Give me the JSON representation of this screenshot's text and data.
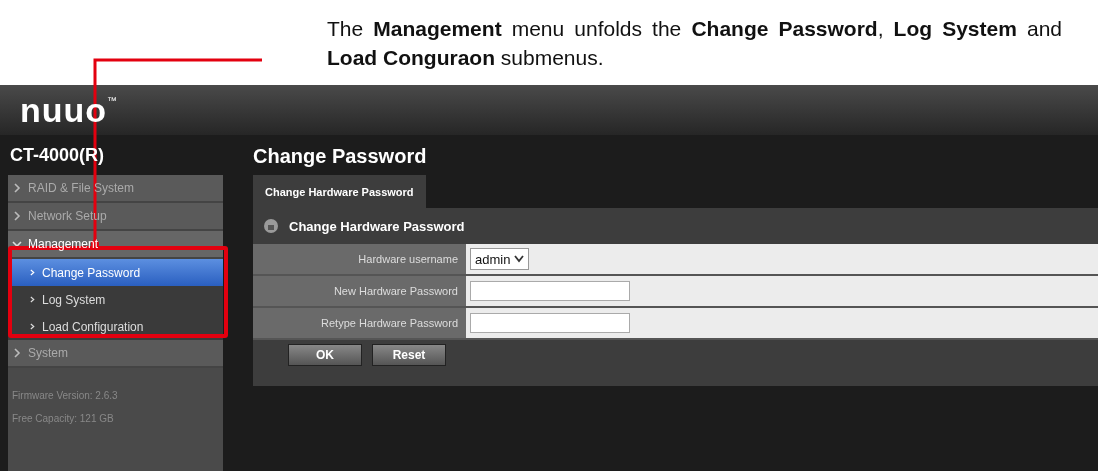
{
  "caption": "The **Management** menu unfolds the **Change Password**, **Log System** and **Load Conguraon** submenus.",
  "header": {
    "logo": "nuuo",
    "trademark": "™"
  },
  "sidebar": {
    "device": "CT-4000(R)",
    "items": [
      {
        "label": "RAID & File System",
        "expanded": false
      },
      {
        "label": "Network Setup",
        "expanded": false
      },
      {
        "label": "Management",
        "expanded": true,
        "children": [
          {
            "label": "Change Password",
            "selected": true
          },
          {
            "label": "Log System",
            "selected": false
          },
          {
            "label": "Load Configuration",
            "selected": false
          }
        ]
      },
      {
        "label": "System",
        "expanded": false
      }
    ],
    "info": [
      "Firmware Version: 2.6.3",
      "Free Capacity: 121 GB"
    ]
  },
  "main": {
    "title": "Change Password",
    "tabs": [
      {
        "label": "Change Hardware Password",
        "selected": true
      }
    ],
    "section": "Change Hardware Password",
    "rows": [
      {
        "kind": "select",
        "label": "Hardware username",
        "value": "admin"
      },
      {
        "kind": "input",
        "label": "New Hardware Password"
      },
      {
        "kind": "input",
        "label": "Retype Hardware Password"
      }
    ],
    "buttons": [
      "OK",
      "Reset"
    ]
  }
}
